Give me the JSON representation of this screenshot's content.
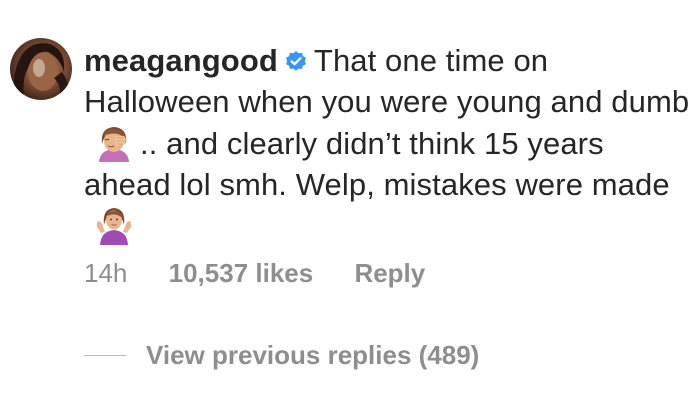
{
  "comment": {
    "username": "meagangood",
    "verified_icon": "verified-badge-icon",
    "text_part1": "That one time on Halloween when you were young and dumb",
    "emoji1": "facepalm-emoji",
    "text_part2": ".. and clearly didn’t think 15 years ahead lol smh. Welp, mistakes were made",
    "emoji2": "shrug-emoji",
    "timestamp": "14h",
    "likes": "10,537 likes",
    "reply_label": "Reply",
    "view_replies": "View previous replies (489)"
  },
  "colors": {
    "text": "#262626",
    "muted": "#8e8e8e",
    "verified": "#3897f0"
  }
}
